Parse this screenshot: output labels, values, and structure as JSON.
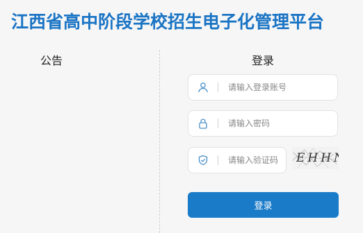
{
  "header": {
    "title": "江西省高中阶段学校招生电子化管理平台"
  },
  "notice": {
    "heading": "公告"
  },
  "login": {
    "heading": "登录",
    "account_placeholder": "请输入登录账号",
    "password_placeholder": "请输入密码",
    "captcha_placeholder": "请输入验证码",
    "captcha_text": "EHHN",
    "submit_label": "登录"
  },
  "icons": {
    "account": "user-icon",
    "password": "lock-icon",
    "captcha": "shield-icon"
  },
  "colors": {
    "brand": "#1a74c4",
    "button": "#1a7bc8",
    "icon": "#4a90c8"
  }
}
